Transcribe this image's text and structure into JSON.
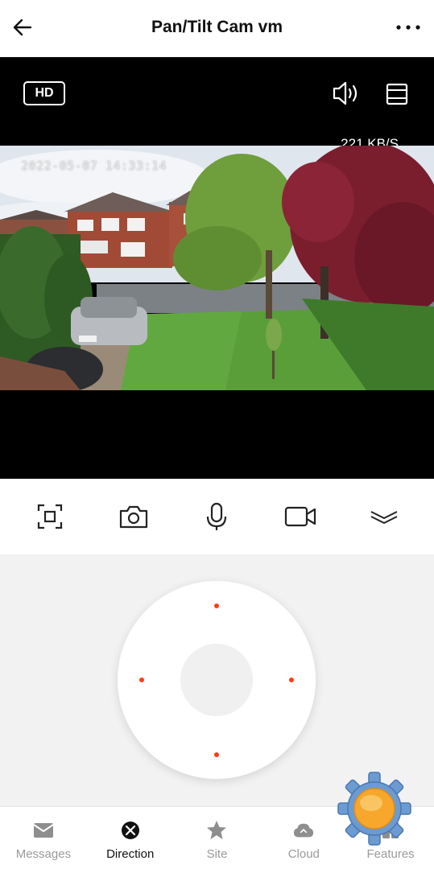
{
  "header": {
    "title": "Pan/Tilt Cam vm",
    "back_icon": "arrow-left-icon",
    "more_icon": "more-dots-icon"
  },
  "video": {
    "hd_label": "HD",
    "speed": "221 KB/S",
    "timestamp": "2022-05-07 14:33:14"
  },
  "toolbar": {
    "items": [
      {
        "name": "screenshot-frame-icon"
      },
      {
        "name": "camera-icon"
      },
      {
        "name": "microphone-icon"
      },
      {
        "name": "video-record-icon"
      },
      {
        "name": "collapse-chevron-icon"
      }
    ]
  },
  "controls": {
    "accent_color": "#ff3b1a"
  },
  "nav": {
    "items": [
      {
        "label": "Messages",
        "icon": "envelope-icon",
        "active": false
      },
      {
        "label": "Direction",
        "icon": "direction-icon",
        "active": true
      },
      {
        "label": "Site",
        "icon": "star-icon",
        "active": false
      },
      {
        "label": "Cloud",
        "icon": "cloud-icon",
        "active": false
      },
      {
        "label": "Features",
        "icon": "grid-icon",
        "active": false
      }
    ]
  }
}
